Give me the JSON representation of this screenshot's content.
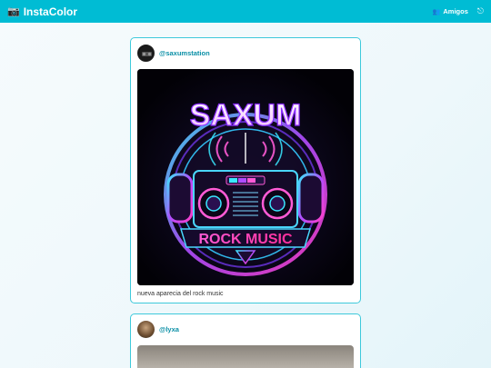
{
  "app": {
    "title": "InstaColor",
    "logo_icon": "camera-icon"
  },
  "nav": {
    "friends_label": "Amigos",
    "friends_icon": "people-icon",
    "logout_icon": "logout-icon"
  },
  "posts": [
    {
      "username": "@saxumstation",
      "image": {
        "title": "SAXUM",
        "subtitle": "ROCK MUSIC",
        "alt": "Saxum rock music neon boombox logo"
      },
      "caption": "nueva aparecia del rock music"
    },
    {
      "username": "@lyxa"
    }
  ],
  "colors": {
    "accent": "#00bcd4",
    "card_border": "#3ec9db",
    "username": "#0a8fa6"
  }
}
